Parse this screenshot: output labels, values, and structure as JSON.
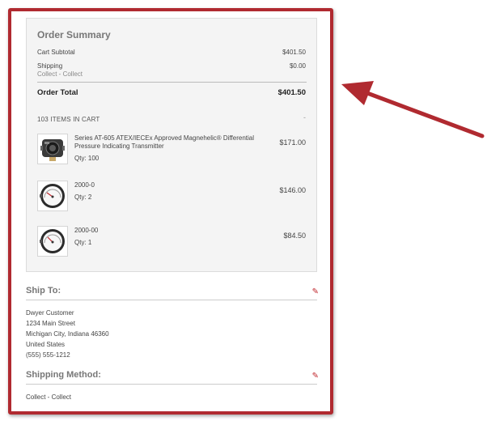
{
  "summary": {
    "title": "Order Summary",
    "subtotal_label": "Cart Subtotal",
    "subtotal_value": "$401.50",
    "shipping_label": "Shipping",
    "shipping_method": "Collect - Collect",
    "shipping_value": "$0.00",
    "total_label": "Order Total",
    "total_value": "$401.50",
    "items_heading": "103 ITEMS IN CART",
    "collapse_glyph": "-"
  },
  "items": [
    {
      "name": "Series AT-605 ATEX/IECEx Approved Magnehelic® Differential Pressure Indicating Transmitter",
      "qty": "Qty: 100",
      "price": "$171.00",
      "icon": "transmitter-icon"
    },
    {
      "name": "2000-0",
      "qty": "Qty: 2",
      "price": "$146.00",
      "icon": "pressure-gauge-icon"
    },
    {
      "name": "2000-00",
      "qty": "Qty: 1",
      "price": "$84.50",
      "icon": "pressure-gauge-icon"
    }
  ],
  "ship_to": {
    "title": "Ship To:",
    "name": "Dwyer Customer",
    "street": "1234 Main Street",
    "city": "Michigan City, Indiana 46360",
    "country": "United States",
    "phone": "(555) 555-1212"
  },
  "shipping_method": {
    "title": "Shipping Method:",
    "value": "Collect - Collect"
  },
  "colors": {
    "frame": "#b02a30",
    "accent": "#c0272d",
    "panel": "#f4f4f4"
  }
}
